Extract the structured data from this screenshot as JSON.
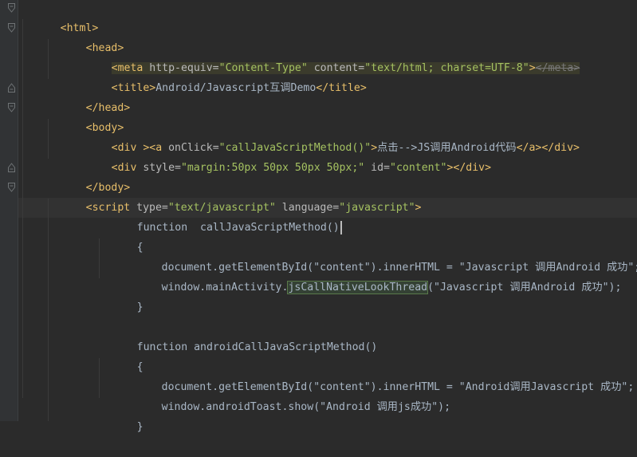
{
  "editor": {
    "language": "html",
    "colors": {
      "background": "#2b2b2b",
      "tag": "#e8bf6a",
      "attribute": "#bababa",
      "string": "#a5c261",
      "text": "#a9b7c6",
      "keyword": "#cc7832"
    },
    "lines": {
      "l1": {
        "tag_html": "<html>"
      },
      "l2": {
        "tag_head": "<head>"
      },
      "l3": {
        "tag_meta": "<meta",
        "attr1": " http-equiv=",
        "val1": "\"Content-Type\"",
        "attr2": " content=",
        "val2": "\"text/html; charset=UTF-8\"",
        "end_gt": ">",
        "close_meta": "</meta>"
      },
      "l4": {
        "open": "<title>",
        "text": "Android/Javascript互调Demo",
        "close": "</title>"
      },
      "l5": {
        "tag": "</head>"
      },
      "l6": {
        "tag": "<body>"
      },
      "l7": {
        "div_open": "<div >",
        "a_open": "<a",
        "attr": " onClick=",
        "val": "\"callJavaScriptMethod()\"",
        "gt": ">",
        "text": "点击-->JS调用Android代码",
        "a_close": "</a>",
        "div_close": "</div>"
      },
      "l8": {
        "div_open": "<div",
        "attr1": " style=",
        "val1": "\"margin:50px 50px 50px 50px;\"",
        "attr2": " id=",
        "val2": "\"content\"",
        "gt": ">",
        "div_close": "</div>"
      },
      "l9": {
        "tag": "</body>"
      },
      "l10": {
        "script_open": "<script",
        "attr1": " type=",
        "val1": "\"text/javascript\"",
        "attr2": " language=",
        "val2": "\"javascript\"",
        "gt": ">"
      },
      "l11": {
        "text": "function  callJavaScriptMethod()"
      },
      "l12": {
        "text": "{"
      },
      "l13": {
        "text": "document.getElementById(\"content\").innerHTML = \"Javascript 调用Android 成功\";"
      },
      "l14": {
        "prefix": "window.mainActivity.",
        "identifier": "jsCallNativeLookThread",
        "suffix": "(\"Javascript 调用Android 成功\");"
      },
      "l15": {
        "text": "}"
      },
      "l17": {
        "text": "function androidCallJavaScriptMethod()"
      },
      "l18": {
        "text": "{"
      },
      "l19": {
        "text": "document.getElementById(\"content\").innerHTML = \"Android调用Javascript 成功\";"
      },
      "l20": {
        "text": "window.androidToast.show(\"Android 调用js成功\");"
      },
      "l21": {
        "text": "}"
      }
    }
  }
}
